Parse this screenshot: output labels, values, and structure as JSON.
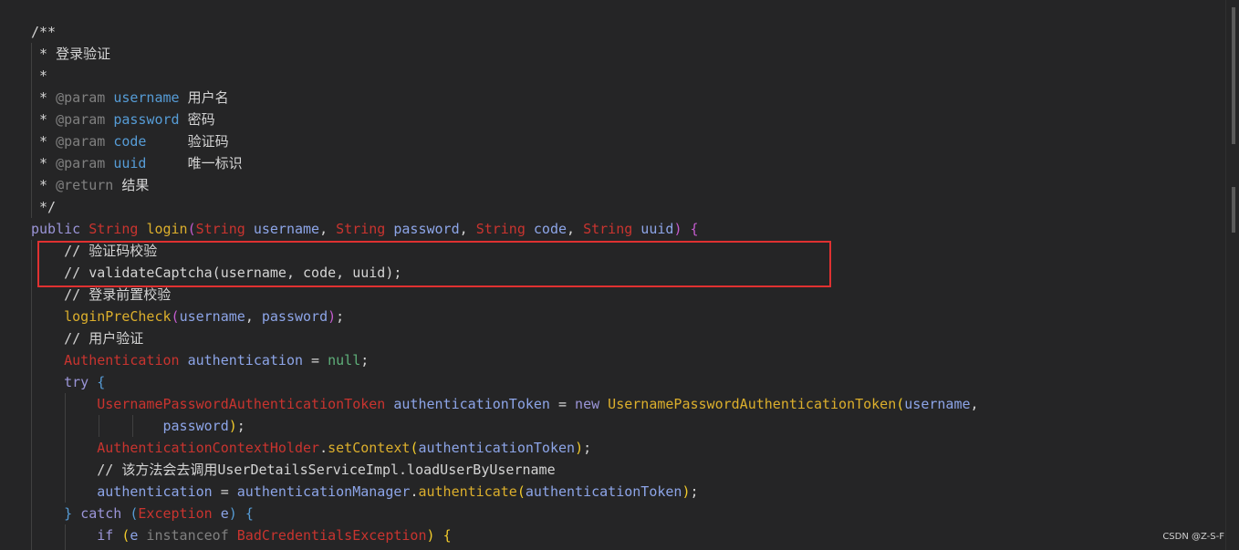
{
  "colors": {
    "comment": "#d4d4d4",
    "doc_tag": "#808080",
    "param": "#569cd6",
    "keyword": "#9b95d8",
    "type": "#c9342f",
    "method": "#dcaf2c",
    "variable": "#8da5e8",
    "paren": "#c45ccf",
    "brace": "#f2cb2b",
    "plain": "#d4d4d4",
    "null": "#5fb07a",
    "highlight_box": "#e03131"
  },
  "code_lines": [
    [
      {
        "t": "/**",
        "c": "comment"
      }
    ],
    [
      {
        "t": " * 登录验证",
        "c": "comment"
      }
    ],
    [
      {
        "t": " *",
        "c": "comment"
      }
    ],
    [
      {
        "t": " * ",
        "c": "comment"
      },
      {
        "t": "@param",
        "c": "doc_tag"
      },
      {
        "t": " ",
        "c": "comment"
      },
      {
        "t": "username",
        "c": "param"
      },
      {
        "t": " 用户名",
        "c": "comment"
      }
    ],
    [
      {
        "t": " * ",
        "c": "comment"
      },
      {
        "t": "@param",
        "c": "doc_tag"
      },
      {
        "t": " ",
        "c": "comment"
      },
      {
        "t": "password",
        "c": "param"
      },
      {
        "t": " 密码",
        "c": "comment"
      }
    ],
    [
      {
        "t": " * ",
        "c": "comment"
      },
      {
        "t": "@param",
        "c": "doc_tag"
      },
      {
        "t": " ",
        "c": "comment"
      },
      {
        "t": "code",
        "c": "param"
      },
      {
        "t": "     验证码",
        "c": "comment"
      }
    ],
    [
      {
        "t": " * ",
        "c": "comment"
      },
      {
        "t": "@param",
        "c": "doc_tag"
      },
      {
        "t": " ",
        "c": "comment"
      },
      {
        "t": "uuid",
        "c": "param"
      },
      {
        "t": "     唯一标识",
        "c": "comment"
      }
    ],
    [
      {
        "t": " * ",
        "c": "comment"
      },
      {
        "t": "@return",
        "c": "doc_tag"
      },
      {
        "t": " 结果",
        "c": "comment"
      }
    ],
    [
      {
        "t": " */",
        "c": "comment"
      }
    ],
    [
      {
        "t": "public ",
        "c": "keyword"
      },
      {
        "t": "String",
        "c": "type"
      },
      {
        "t": " ",
        "c": "plain"
      },
      {
        "t": "login",
        "c": "method"
      },
      {
        "t": "(",
        "c": "paren"
      },
      {
        "t": "String",
        "c": "type"
      },
      {
        "t": " username",
        "c": "variable"
      },
      {
        "t": ", ",
        "c": "plain"
      },
      {
        "t": "String",
        "c": "type"
      },
      {
        "t": " password",
        "c": "variable"
      },
      {
        "t": ", ",
        "c": "plain"
      },
      {
        "t": "String",
        "c": "type"
      },
      {
        "t": " code",
        "c": "variable"
      },
      {
        "t": ", ",
        "c": "plain"
      },
      {
        "t": "String",
        "c": "type"
      },
      {
        "t": " uuid",
        "c": "variable"
      },
      {
        "t": ")",
        "c": "paren"
      },
      {
        "t": " ",
        "c": "plain"
      },
      {
        "t": "{",
        "c": "paren"
      }
    ],
    [
      {
        "t": "    // 验证码校验",
        "c": "comment"
      }
    ],
    [
      {
        "t": "    // validateCaptcha(username, code, uuid);",
        "c": "comment"
      }
    ],
    [
      {
        "t": "    // 登录前置校验",
        "c": "comment"
      }
    ],
    [
      {
        "t": "    ",
        "c": "plain"
      },
      {
        "t": "loginPreCheck",
        "c": "method"
      },
      {
        "t": "(",
        "c": "paren"
      },
      {
        "t": "username",
        "c": "variable"
      },
      {
        "t": ", ",
        "c": "plain"
      },
      {
        "t": "password",
        "c": "variable"
      },
      {
        "t": ")",
        "c": "paren"
      },
      {
        "t": ";",
        "c": "plain"
      }
    ],
    [
      {
        "t": "    // 用户验证",
        "c": "comment"
      }
    ],
    [
      {
        "t": "    ",
        "c": "plain"
      },
      {
        "t": "Authentication",
        "c": "type"
      },
      {
        "t": " authentication",
        "c": "variable"
      },
      {
        "t": " = ",
        "c": "plain"
      },
      {
        "t": "null",
        "c": "null"
      },
      {
        "t": ";",
        "c": "plain"
      }
    ],
    [
      {
        "t": "    ",
        "c": "plain"
      },
      {
        "t": "try",
        "c": "keyword"
      },
      {
        "t": " ",
        "c": "plain"
      },
      {
        "t": "{",
        "c": "param"
      }
    ],
    [
      {
        "t": "        ",
        "c": "plain"
      },
      {
        "t": "UsernamePasswordAuthenticationToken",
        "c": "type"
      },
      {
        "t": " authenticationToken",
        "c": "variable"
      },
      {
        "t": " = ",
        "c": "plain"
      },
      {
        "t": "new",
        "c": "keyword"
      },
      {
        "t": " ",
        "c": "plain"
      },
      {
        "t": "UsernamePasswordAuthenticationToken",
        "c": "method"
      },
      {
        "t": "(",
        "c": "brace"
      },
      {
        "t": "username",
        "c": "variable"
      },
      {
        "t": ",",
        "c": "plain"
      }
    ],
    [
      {
        "t": "                ",
        "c": "plain"
      },
      {
        "t": "password",
        "c": "variable"
      },
      {
        "t": ")",
        "c": "brace"
      },
      {
        "t": ";",
        "c": "plain"
      }
    ],
    [
      {
        "t": "        ",
        "c": "plain"
      },
      {
        "t": "AuthenticationContextHolder",
        "c": "type"
      },
      {
        "t": ".",
        "c": "plain"
      },
      {
        "t": "setContext",
        "c": "method"
      },
      {
        "t": "(",
        "c": "brace"
      },
      {
        "t": "authenticationToken",
        "c": "variable"
      },
      {
        "t": ")",
        "c": "brace"
      },
      {
        "t": ";",
        "c": "plain"
      }
    ],
    [
      {
        "t": "        // 该方法会去调用UserDetailsServiceImpl.loadUserByUsername",
        "c": "comment"
      }
    ],
    [
      {
        "t": "        ",
        "c": "plain"
      },
      {
        "t": "authentication",
        "c": "variable"
      },
      {
        "t": " = ",
        "c": "plain"
      },
      {
        "t": "authenticationManager",
        "c": "variable"
      },
      {
        "t": ".",
        "c": "plain"
      },
      {
        "t": "authenticate",
        "c": "method"
      },
      {
        "t": "(",
        "c": "brace"
      },
      {
        "t": "authenticationToken",
        "c": "variable"
      },
      {
        "t": ")",
        "c": "brace"
      },
      {
        "t": ";",
        "c": "plain"
      }
    ],
    [
      {
        "t": "    ",
        "c": "plain"
      },
      {
        "t": "}",
        "c": "param"
      },
      {
        "t": " ",
        "c": "plain"
      },
      {
        "t": "catch",
        "c": "keyword"
      },
      {
        "t": " ",
        "c": "plain"
      },
      {
        "t": "(",
        "c": "param"
      },
      {
        "t": "Exception",
        "c": "type"
      },
      {
        "t": " e",
        "c": "variable"
      },
      {
        "t": ")",
        "c": "param"
      },
      {
        "t": " ",
        "c": "plain"
      },
      {
        "t": "{",
        "c": "param"
      }
    ],
    [
      {
        "t": "        ",
        "c": "plain"
      },
      {
        "t": "if",
        "c": "keyword"
      },
      {
        "t": " ",
        "c": "plain"
      },
      {
        "t": "(",
        "c": "brace"
      },
      {
        "t": "e",
        "c": "variable"
      },
      {
        "t": " instanceof ",
        "c": "doc_tag"
      },
      {
        "t": "BadCredentialsException",
        "c": "type"
      },
      {
        "t": ")",
        "c": "brace"
      },
      {
        "t": " ",
        "c": "plain"
      },
      {
        "t": "{",
        "c": "brace"
      }
    ]
  ],
  "watermark": "CSDN @Z-S-F"
}
